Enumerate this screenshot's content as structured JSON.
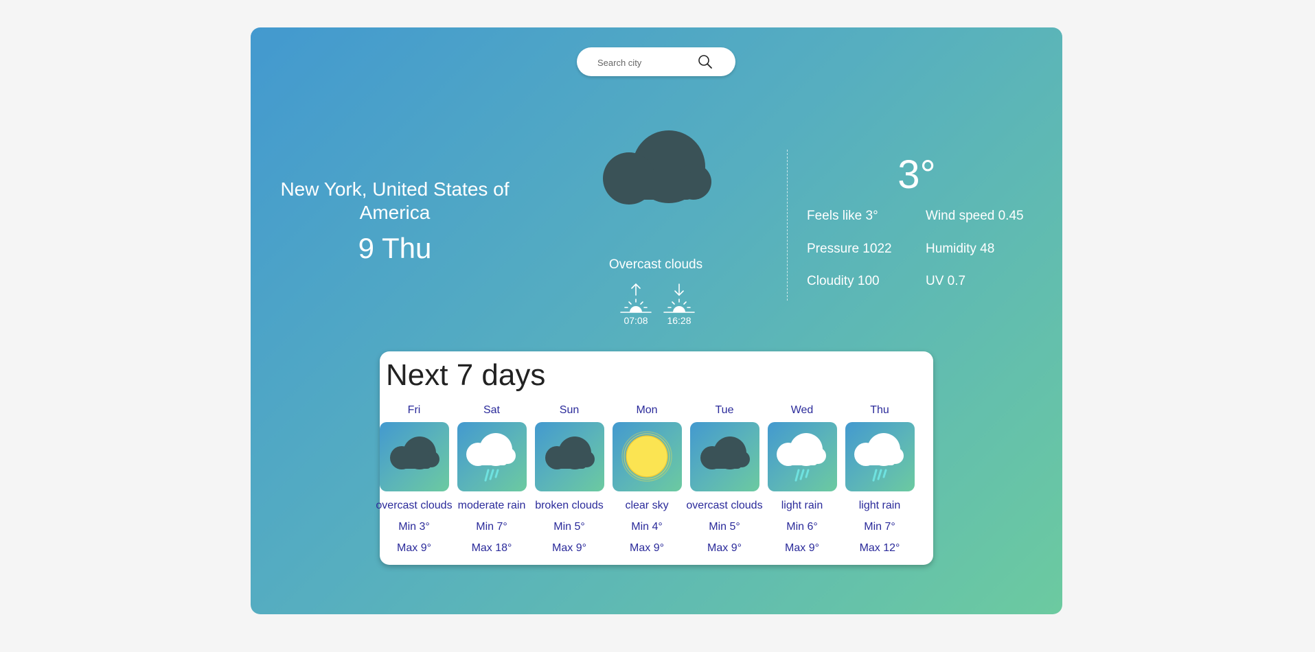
{
  "search": {
    "placeholder": "Search city"
  },
  "current": {
    "location": "New York, United States of America",
    "date": "9 Thu",
    "description": "Overcast clouds",
    "sunrise": "07:08",
    "sunset": "16:28",
    "temperature": "3°",
    "icon": "overcast-cloud-icon"
  },
  "stats": {
    "feels_like": "Feels like 3°",
    "wind_speed": "Wind speed 0.45",
    "pressure": "Pressure 1022",
    "humidity": "Humidity 48",
    "cloudiness": "Cloudity 100",
    "uv": "UV 0.7"
  },
  "forecast": {
    "title": "Next 7 days",
    "days": [
      {
        "name": "Fri",
        "icon": "overcast-cloud-icon",
        "description": "overcast clouds",
        "min": "Min 3°",
        "max": "Max 9°"
      },
      {
        "name": "Sat",
        "icon": "rain-cloud-icon",
        "description": "moderate rain",
        "min": "Min 7°",
        "max": "Max 18°"
      },
      {
        "name": "Sun",
        "icon": "broken-cloud-icon",
        "description": "broken clouds",
        "min": "Min 5°",
        "max": "Max 9°"
      },
      {
        "name": "Mon",
        "icon": "sun-icon",
        "description": "clear sky",
        "min": "Min 4°",
        "max": "Max 9°"
      },
      {
        "name": "Tue",
        "icon": "overcast-cloud-icon",
        "description": "overcast clouds",
        "min": "Min 5°",
        "max": "Max 9°"
      },
      {
        "name": "Wed",
        "icon": "rain-cloud-icon",
        "description": "light rain",
        "min": "Min 6°",
        "max": "Max 9°"
      },
      {
        "name": "Thu",
        "icon": "rain-cloud-icon",
        "description": "light rain",
        "min": "Min 7°",
        "max": "Max 12°"
      }
    ]
  },
  "colors": {
    "gradient_start": "#4399cf",
    "gradient_end": "#6ccaa0",
    "dark_cloud": "#3a5257",
    "forecast_text": "#2a2a9a",
    "sun": "#f7e14a"
  }
}
